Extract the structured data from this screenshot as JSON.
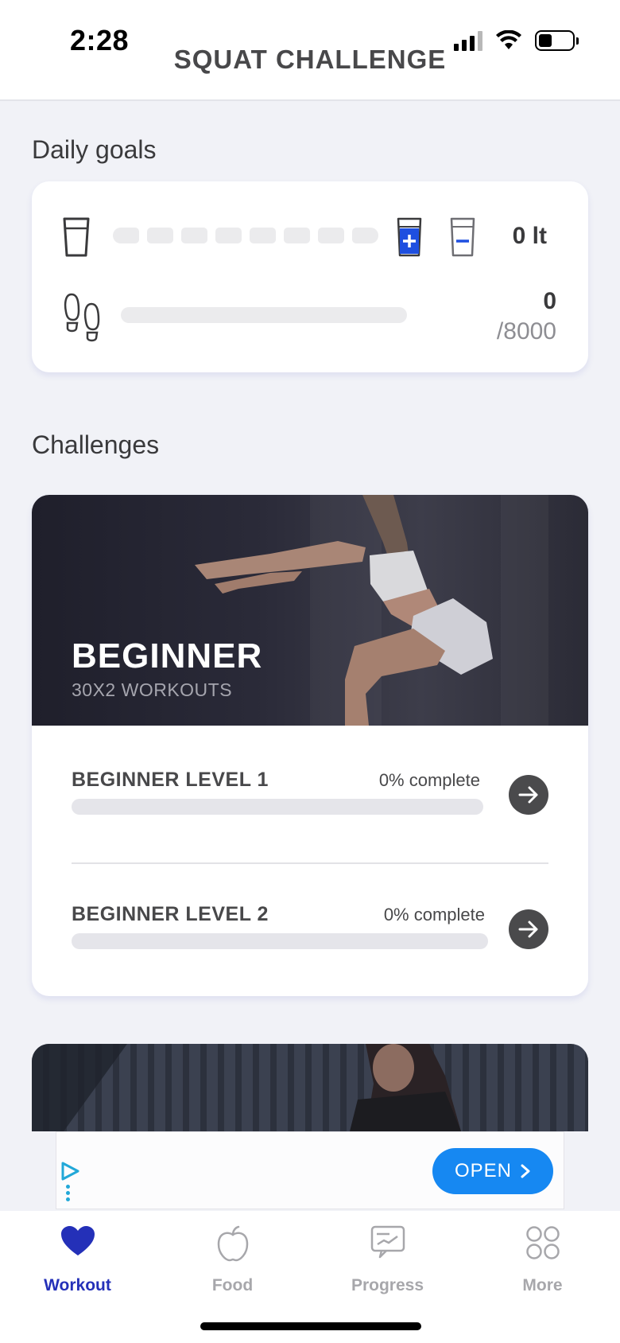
{
  "status_bar": {
    "time": "2:28"
  },
  "header": {
    "title": "SQUAT CHALLENGE"
  },
  "daily_goals": {
    "section_title": "Daily goals",
    "water": {
      "value": "0 lt",
      "segments_filled": 0,
      "segments_total": 8
    },
    "steps": {
      "value": "0",
      "goal": "/8000",
      "progress": 0
    }
  },
  "challenges": {
    "section_title": "Challenges",
    "items": [
      {
        "title": "BEGINNER",
        "subtitle": "30X2 WORKOUTS",
        "levels": [
          {
            "name": "BEGINNER LEVEL 1",
            "complete": "0% complete",
            "progress": 0
          },
          {
            "name": "BEGINNER LEVEL 2",
            "complete": "0% complete",
            "progress": 0
          }
        ]
      }
    ]
  },
  "ad": {
    "button_label": "OPEN"
  },
  "tabbar": {
    "accent": "#2430b8",
    "items": [
      {
        "label": "Workout",
        "icon": "heart-icon",
        "active": true
      },
      {
        "label": "Food",
        "icon": "apple-icon",
        "active": false
      },
      {
        "label": "Progress",
        "icon": "progress-chart-icon",
        "active": false
      },
      {
        "label": "More",
        "icon": "grid-icon",
        "active": false
      }
    ]
  }
}
